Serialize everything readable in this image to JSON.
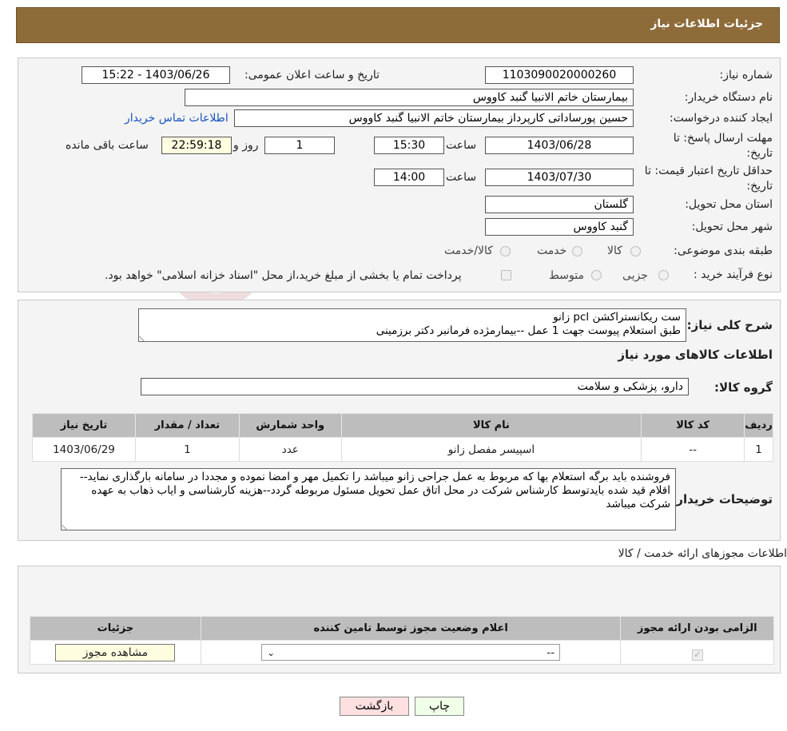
{
  "header": {
    "title": "جزئیات اطلاعات نیاز"
  },
  "form": {
    "need_number_label": "شماره نیاز:",
    "need_number": "1103090020000260",
    "announce_label": "تاریخ و ساعت اعلان عمومی:",
    "announce_value": "1403/06/26 - 15:22",
    "buyer_org_label": "نام دستگاه خریدار:",
    "buyer_org": "بیمارستان خاتم الانبیا گنبد کاووس",
    "creator_label": "ایجاد کننده درخواست:",
    "creator": "حسین پورساداتی کارپرداز بیمارستان خاتم الانبیا گنبد کاووس",
    "contact_link": "اطلاعات تماس خریدار",
    "deadline_label": "مهلت ارسال پاسخ: تا تاریخ:",
    "deadline_date": "1403/06/28",
    "time_label": "ساعت",
    "deadline_time": "15:30",
    "days_value": "1",
    "days_label": "روز و",
    "remaining_time": "22:59:18",
    "remaining_label": "ساعت باقی مانده",
    "validity_label": "حداقل تاریخ اعتبار قیمت: تا تاریخ:",
    "validity_date": "1403/07/30",
    "validity_time": "14:00",
    "province_label": "استان محل تحویل:",
    "province": "گلستان",
    "city_label": "شهر محل تحویل:",
    "city": "گنبد کاووس",
    "category_label": "طبقه بندی موضوعی:",
    "category_options": [
      "کالا",
      "خدمت",
      "کالا/خدمت"
    ],
    "process_label": "نوع فرآیند خرید :",
    "process_options": [
      "جزیی",
      "متوسط"
    ],
    "process_note": "پرداخت تمام یا بخشی از مبلغ خرید،از محل \"اسناد خزانه اسلامی\" خواهد بود."
  },
  "details": {
    "summary_label": "شرح کلی نیاز:",
    "summary_line1": "ست ریکانستراکشن pcl زانو",
    "summary_line2": "طبق استعلام پیوست جهت 1 عمل --بیمارمژده فرمانبر دکتر برزمینی",
    "goods_info_title": "اطلاعات کالاهای مورد نیاز",
    "goods_group_label": "گروه کالا:",
    "goods_group": "دارو، پزشکی و سلامت",
    "table_headers": [
      "ردیف",
      "کد کالا",
      "نام کالا",
      "واحد شمارش",
      "تعداد / مقدار",
      "تاریخ نیاز"
    ],
    "table_rows": [
      [
        "1",
        "--",
        "اسپیسر مفصل زانو",
        "عدد",
        "1",
        "1403/06/29"
      ]
    ],
    "buyer_notes_label": "توضیحات خریدار:",
    "buyer_notes": "فروشنده باید برگه استعلام بها که مربوط به عمل جراحی زانو میباشد را  تکمیل مهر و امضا نموده و مجددا در سامانه بارگذاری نماید-- اقلام قید شده بایدتوسط کارشناس شرکت در محل اتاق عمل تحویل مسئول مربوطه گردد--هزینه کارشناسی و ایاب ذهاب به عهده شرکت میباشد"
  },
  "licenses": {
    "title": "اطلاعات مجوزهای ارائه خدمت / کالا",
    "headers": [
      "الزامی بودن ارائه مجوز",
      "اعلام وضعیت مجوز توسط تامین کننده",
      "جزئیات"
    ],
    "select_value": "--",
    "view_button": "مشاهده مجوز"
  },
  "buttons": {
    "print": "چاپ",
    "back": "بازگشت"
  },
  "watermark": "AriaTender.neT",
  "colors": {
    "header": "#8e6c3a",
    "link": "#1a55c2",
    "back_button": "#ffe0e0",
    "print_button": "#f0ffe8",
    "view_button": "#fffde0"
  }
}
